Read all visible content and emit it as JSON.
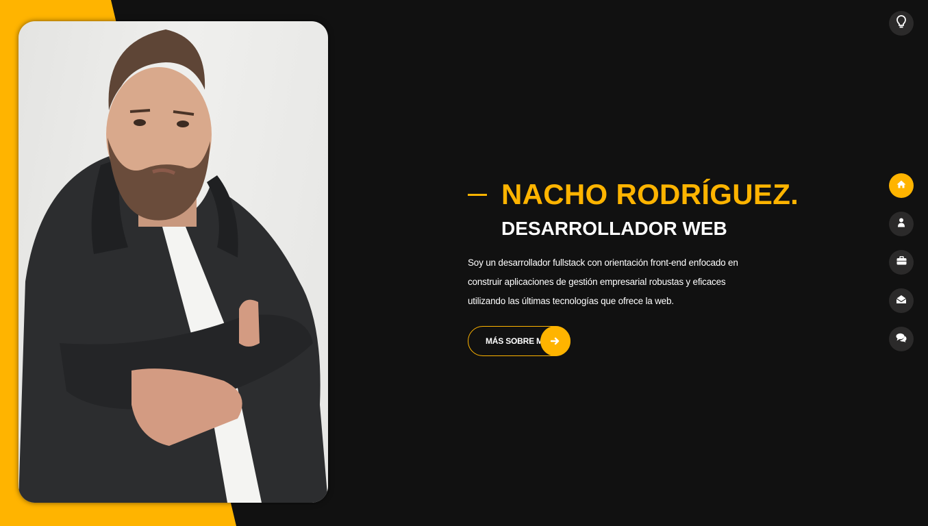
{
  "hero": {
    "name": "NACHO RODRÍGUEZ.",
    "role": "DESARROLLADOR WEB",
    "bio": "Soy un desarrollador fullstack con orientación front-end enfocado en construir aplicaciones de gestión empresarial robustas y eficaces utilizando las últimas tecnologías que ofrece la web.",
    "cta_label": "MÁS SOBRE MI",
    "cta_icon": "arrow-right-icon"
  },
  "theme_toggle": {
    "icon": "lightbulb-icon"
  },
  "nav": {
    "items": [
      {
        "icon": "home-icon",
        "active": true
      },
      {
        "icon": "user-icon",
        "active": false
      },
      {
        "icon": "briefcase-icon",
        "active": false
      },
      {
        "icon": "envelope-open-icon",
        "active": false
      },
      {
        "icon": "comments-icon",
        "active": false
      }
    ]
  },
  "colors": {
    "accent": "#ffb400",
    "background": "#111111",
    "nav_button": "#2b2a2a",
    "text": "#ffffff"
  }
}
